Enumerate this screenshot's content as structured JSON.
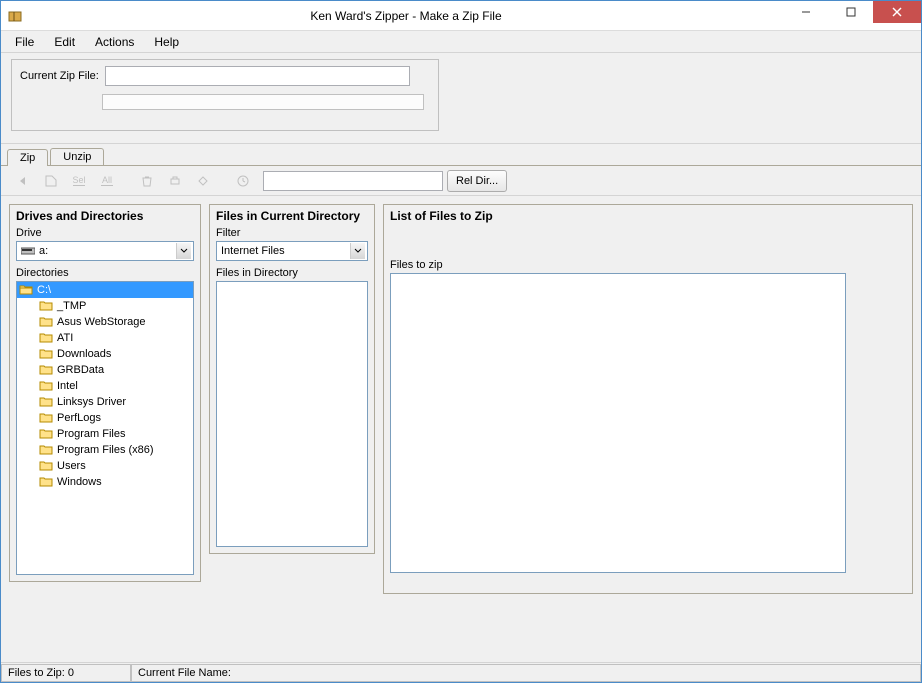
{
  "window": {
    "title": "Ken Ward's Zipper - Make a Zip File"
  },
  "menu": {
    "file": "File",
    "edit": "Edit",
    "actions": "Actions",
    "help": "Help"
  },
  "header": {
    "current_zip_label": "Current Zip File:",
    "current_zip_value": ""
  },
  "tabs": {
    "zip": "Zip",
    "unzip": "Unzip"
  },
  "toolbar2": {
    "sel": "Sel",
    "all": "All",
    "path_value": "",
    "reldir": "Rel Dir..."
  },
  "panels": {
    "drives_title": "Drives and Directories",
    "drive_label": "Drive",
    "drive_value": "a:",
    "directories_label": "Directories",
    "files_title": "Files in Current Directory",
    "filter_label": "Filter",
    "filter_value": "Internet Files",
    "files_in_dir_label": "Files in Directory",
    "zip_list_title": "List of Files to Zip",
    "files_to_zip_label": "Files to zip"
  },
  "directories": {
    "root": "C:\\",
    "items": [
      "_TMP",
      "Asus WebStorage",
      "ATI",
      "Downloads",
      "GRBData",
      "Intel",
      "Linksys Driver",
      "PerfLogs",
      "Program Files",
      "Program Files (x86)",
      "Users",
      "Windows"
    ]
  },
  "statusbar": {
    "files_to_zip": "Files to Zip: 0",
    "current_file_name": "Current File Name:"
  }
}
